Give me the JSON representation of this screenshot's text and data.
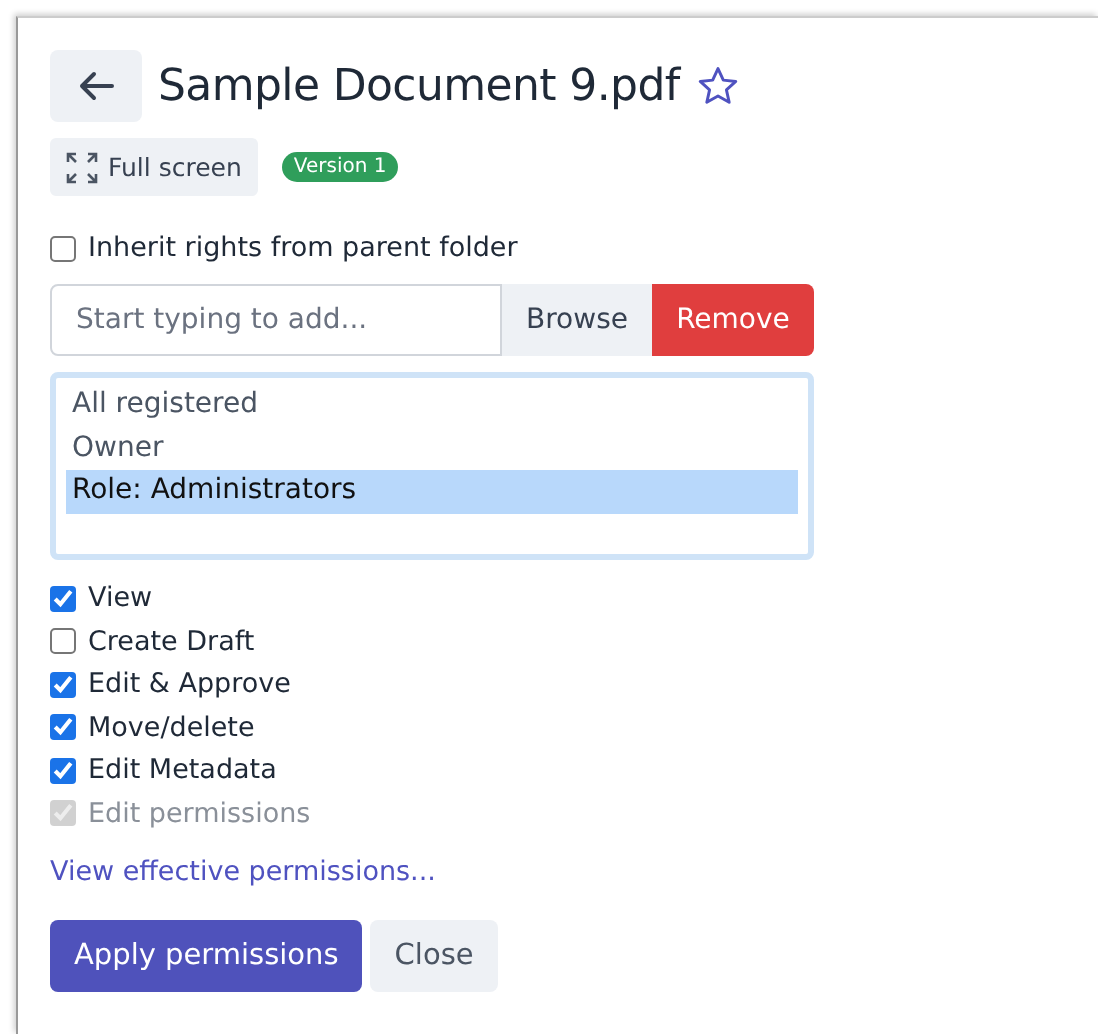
{
  "title": "Sample Document 9.pdf",
  "favorite": false,
  "fullscreen_button": "Full screen",
  "version_badge": "Version 1",
  "inherit": {
    "label": "Inherit rights from parent folder",
    "checked": false
  },
  "add_field": {
    "placeholder": "Start typing to add..."
  },
  "browse_button": "Browse",
  "remove_button": "Remove",
  "principals": [
    {
      "label": "All registered",
      "selected": false
    },
    {
      "label": "Owner",
      "selected": false
    },
    {
      "label": "Role: Administrators",
      "selected": true
    }
  ],
  "permissions": [
    {
      "label": "View",
      "checked": true,
      "disabled": false
    },
    {
      "label": "Create Draft",
      "checked": false,
      "disabled": false
    },
    {
      "label": "Edit & Approve",
      "checked": true,
      "disabled": false
    },
    {
      "label": "Move/delete",
      "checked": true,
      "disabled": false
    },
    {
      "label": "Edit Metadata",
      "checked": true,
      "disabled": false
    },
    {
      "label": "Edit permissions",
      "checked": true,
      "disabled": true
    }
  ],
  "effective_link": "View effective permissions...",
  "apply_button": "Apply permissions",
  "close_button": "Close"
}
